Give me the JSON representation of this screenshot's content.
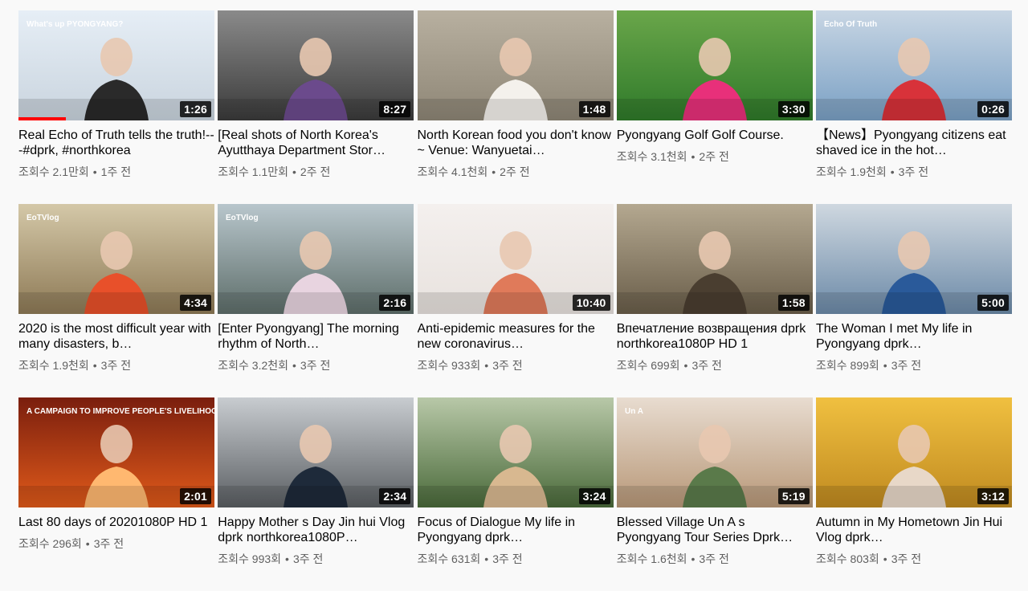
{
  "videos": [
    {
      "title": "Real Echo of Truth tells the truth!---#dprk, #northkorea",
      "views": "조회수 2.1만회",
      "age": "1주 전",
      "duration": "1:26",
      "watch_progress": 0.24,
      "thumb": {
        "bg": [
          "#e6eef6",
          "#c9d4de"
        ],
        "accent": "#2a2a2a",
        "overlay_text": "What's up PYONGYANG?"
      }
    },
    {
      "title": "[Real shots of North Korea's Ayutthaya Department Stor…",
      "views": "조회수 1.1만회",
      "age": "2주 전",
      "duration": "8:27",
      "thumb": {
        "bg": [
          "#8a8a8a",
          "#3b3b3b"
        ],
        "accent": "#6b4a8c"
      }
    },
    {
      "title": "North Korean food you don't know ~ Venue: Wanyuetai…",
      "views": "조회수 4.1천회",
      "age": "2주 전",
      "duration": "1:48",
      "thumb": {
        "bg": [
          "#b8b0a0",
          "#8e8676"
        ],
        "accent": "#f4f1ec"
      }
    },
    {
      "title": "Pyongyang Golf Golf Course.",
      "views": "조회수 3.1천회",
      "age": "2주 전",
      "duration": "3:30",
      "thumb": {
        "bg": [
          "#6aa64a",
          "#2f7a2a"
        ],
        "accent": "#e8307a"
      }
    },
    {
      "title": "【News】Pyongyang citizens eat shaved ice in the hot…",
      "views": "조회수 1.9천회",
      "age": "3주 전",
      "duration": "0:26",
      "thumb": {
        "bg": [
          "#c8d6e4",
          "#7aa0c4"
        ],
        "accent": "#d8323a",
        "overlay_text": "Echo Of Truth"
      }
    },
    {
      "title": "2020 is the most difficult year with many disasters, b…",
      "views": "조회수 1.9천회",
      "age": "3주 전",
      "duration": "4:34",
      "thumb": {
        "bg": [
          "#d4c8a8",
          "#8e7a56"
        ],
        "accent": "#e8502a",
        "overlay_text": "EoTVlog"
      }
    },
    {
      "title": "[Enter Pyongyang] The morning rhythm of North…",
      "views": "조회수 3.2천회",
      "age": "3주 전",
      "duration": "2:16",
      "thumb": {
        "bg": [
          "#b8c6cc",
          "#5e6e6a"
        ],
        "accent": "#e8d4e0",
        "overlay_text": "EoTVlog"
      }
    },
    {
      "title": "Anti-epidemic measures for the new coronavirus…",
      "views": "조회수 933회",
      "age": "3주 전",
      "duration": "10:40",
      "thumb": {
        "bg": [
          "#f4f0ee",
          "#e8e2de"
        ],
        "accent": "#e07a5a"
      }
    },
    {
      "title": "Впечатление возвращения dprk northkorea1080P HD 1",
      "views": "조회수 699회",
      "age": "3주 전",
      "duration": "1:58",
      "thumb": {
        "bg": [
          "#b4a890",
          "#6a5e4a"
        ],
        "accent": "#4a3e30"
      }
    },
    {
      "title": "The Woman I met My life in Pyongyang dprk…",
      "views": "조회수 899회",
      "age": "3주 전",
      "duration": "5:00",
      "thumb": {
        "bg": [
          "#cfd8e0",
          "#6c8aa8"
        ],
        "accent": "#2a5a9a"
      }
    },
    {
      "title": "Last 80 days of 20201080P HD 1",
      "views": "조회수 296회",
      "age": "3주 전",
      "duration": "2:01",
      "thumb": {
        "bg": [
          "#7a1e0e",
          "#e05a1a"
        ],
        "accent": "#ffb870",
        "overlay_text": "A CAMPAIGN TO IMPROVE PEOPLE'S LIVELIHOOD"
      }
    },
    {
      "title": "Happy Mother s Day Jin hui Vlog dprk northkorea1080P…",
      "views": "조회수 993회",
      "age": "3주 전",
      "duration": "2:34",
      "thumb": {
        "bg": [
          "#c8ccd0",
          "#5a5e62"
        ],
        "accent": "#1e2a3a"
      }
    },
    {
      "title": "Focus of Dialogue My life in Pyongyang dprk…",
      "views": "조회수 631회",
      "age": "3주 전",
      "duration": "3:24",
      "thumb": {
        "bg": [
          "#b8c8a8",
          "#4a6a3a"
        ],
        "accent": "#d8b890"
      }
    },
    {
      "title": "Blessed Village Un A s Pyongyang Tour Series Dprk…",
      "views": "조회수 1.6천회",
      "age": "3주 전",
      "duration": "5:19",
      "thumb": {
        "bg": [
          "#e8dcd0",
          "#b89878"
        ],
        "accent": "#5a7a4a",
        "overlay_text": "Un A"
      }
    },
    {
      "title": "Autumn in My Hometown Jin Hui Vlog dprk…",
      "views": "조회수 803회",
      "age": "3주 전",
      "duration": "3:12",
      "thumb": {
        "bg": [
          "#f0c040",
          "#c08a20"
        ],
        "accent": "#e8d8c8"
      }
    }
  ]
}
